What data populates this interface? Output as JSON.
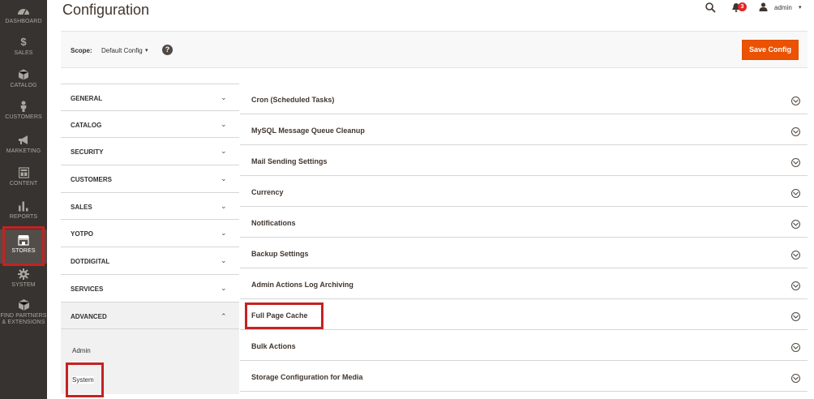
{
  "nav": {
    "items": [
      {
        "key": "dashboard",
        "label": "DASHBOARD",
        "icon": "dashboard-icon"
      },
      {
        "key": "sales",
        "label": "SALES",
        "icon": "dollar-icon"
      },
      {
        "key": "catalog",
        "label": "CATALOG",
        "icon": "box-icon"
      },
      {
        "key": "customers",
        "label": "CUSTOMERS",
        "icon": "person-icon"
      },
      {
        "key": "marketing",
        "label": "MARKETING",
        "icon": "megaphone-icon"
      },
      {
        "key": "content",
        "label": "CONTENT",
        "icon": "layout-icon"
      },
      {
        "key": "reports",
        "label": "REPORTS",
        "icon": "bar-chart-icon"
      },
      {
        "key": "stores",
        "label": "STORES",
        "icon": "store-icon",
        "active": true
      },
      {
        "key": "system",
        "label": "SYSTEM",
        "icon": "gear-icon"
      },
      {
        "key": "partners",
        "label": "FIND PARTNERS & EXTENSIONS",
        "icon": "cube-icon"
      }
    ]
  },
  "header": {
    "title": "Configuration",
    "notification_count": "3",
    "user_name": "admin",
    "icons": [
      "search-icon",
      "bell-icon",
      "user-icon"
    ]
  },
  "scope": {
    "label": "Scope:",
    "value": "Default Config",
    "help": "?",
    "save_label": "Save Config"
  },
  "tabs": [
    {
      "label": "GENERAL",
      "open": false
    },
    {
      "label": "CATALOG",
      "open": false
    },
    {
      "label": "SECURITY",
      "open": false
    },
    {
      "label": "CUSTOMERS",
      "open": false
    },
    {
      "label": "SALES",
      "open": false
    },
    {
      "label": "YOTPO",
      "open": false
    },
    {
      "label": "DOTDIGITAL",
      "open": false
    },
    {
      "label": "SERVICES",
      "open": false
    },
    {
      "label": "ADVANCED",
      "open": true
    }
  ],
  "advanced_items": [
    "Admin",
    "System"
  ],
  "sections": [
    "Cron (Scheduled Tasks)",
    "MySQL Message Queue Cleanup",
    "Mail Sending Settings",
    "Currency",
    "Notifications",
    "Backup Settings",
    "Admin Actions Log Archiving",
    "Full Page Cache",
    "Bulk Actions",
    "Storage Configuration for Media"
  ],
  "colors": {
    "nav_bg": "#373330",
    "accent": "#eb5202",
    "highlight": "#c52222"
  }
}
